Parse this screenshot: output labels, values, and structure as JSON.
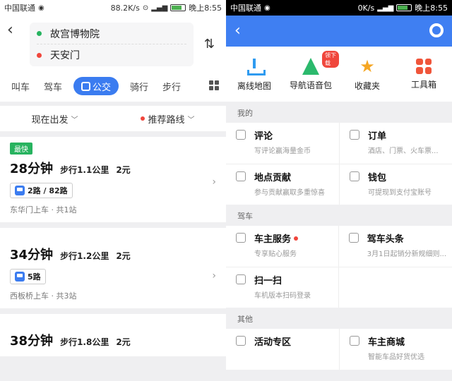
{
  "left": {
    "status": {
      "carrier": "中国联通",
      "speed": "88.2K/s",
      "time": "晚上8:55"
    },
    "route": {
      "from": "故宫博物院",
      "to": "天安门",
      "back_icon": "back-arrow-icon",
      "swap_icon": "swap-icon"
    },
    "modes": [
      {
        "label": "叫车"
      },
      {
        "label": "驾车"
      },
      {
        "label": "公交",
        "active": true
      },
      {
        "label": "骑行"
      },
      {
        "label": "步行"
      }
    ],
    "filters": {
      "depart": "现在出发",
      "recommend": "推荐路线"
    },
    "cards": [
      {
        "badge": "最快",
        "duration": "28分钟",
        "walk": "步行1.1公里",
        "price": "2元",
        "bus": "2路 / 82路",
        "stop": "东华门上车",
        "stations": "共1站"
      },
      {
        "badge": "",
        "duration": "34分钟",
        "walk": "步行1.2公里",
        "price": "2元",
        "bus": "5路",
        "stop": "西板桥上车",
        "stations": "共3站"
      },
      {
        "badge": "",
        "duration": "38分钟",
        "walk": "步行1.8公里",
        "price": "2元",
        "bus": "",
        "stop": "",
        "stations": ""
      }
    ]
  },
  "right": {
    "status": {
      "carrier": "中国联通",
      "speed": "0K/s",
      "time": "晚上8:55"
    },
    "quick": [
      {
        "label": "离线地图",
        "icon": "download-icon"
      },
      {
        "label": "导航语音包",
        "icon": "navigation-voice-icon",
        "badge": "领下载"
      },
      {
        "label": "收藏夹",
        "icon": "star-icon"
      },
      {
        "label": "工具箱",
        "icon": "toolbox-icon"
      }
    ],
    "sections": [
      {
        "label": "我的",
        "items": [
          {
            "title": "评论",
            "sub": "写评论赢海量金币"
          },
          {
            "title": "订单",
            "sub": "酒店、门票、火车票..."
          },
          {
            "title": "地点贡献",
            "sub": "参与贡献赢取多重惊喜"
          },
          {
            "title": "钱包",
            "sub": "可提现到支付宝账号"
          }
        ]
      },
      {
        "label": "驾车",
        "items": [
          {
            "title": "车主服务",
            "sub": "专享贴心服务",
            "dot": true
          },
          {
            "title": "驾车头条",
            "sub": "3月1日起销分新规细则..."
          },
          {
            "title": "扫一扫",
            "sub": "车机版本扫码登录"
          }
        ]
      },
      {
        "label": "其他",
        "items": [
          {
            "title": "活动专区",
            "sub": ""
          },
          {
            "title": "车主商城",
            "sub": "智能车品好货优选"
          }
        ]
      }
    ]
  }
}
